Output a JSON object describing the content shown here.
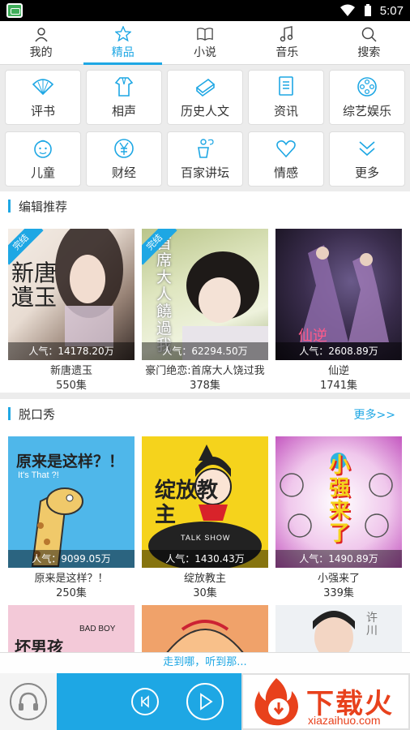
{
  "status": {
    "time": "5:07"
  },
  "tabs": [
    {
      "label": "我的",
      "icon": "person-icon",
      "active": false
    },
    {
      "label": "精品",
      "icon": "star-icon",
      "active": true
    },
    {
      "label": "小说",
      "icon": "book-icon",
      "active": false
    },
    {
      "label": "音乐",
      "icon": "music-note-icon",
      "active": false
    },
    {
      "label": "搜索",
      "icon": "search-icon",
      "active": false
    }
  ],
  "categories": [
    {
      "label": "评书",
      "icon": "fan-icon"
    },
    {
      "label": "相声",
      "icon": "robe-icon"
    },
    {
      "label": "历史人文",
      "icon": "scroll-book-icon"
    },
    {
      "label": "资讯",
      "icon": "document-icon"
    },
    {
      "label": "综艺娱乐",
      "icon": "film-reel-icon"
    },
    {
      "label": "儿童",
      "icon": "child-face-icon"
    },
    {
      "label": "财经",
      "icon": "yen-coin-icon"
    },
    {
      "label": "百家讲坛",
      "icon": "lectern-icon"
    },
    {
      "label": "情感",
      "icon": "heart-icon"
    },
    {
      "label": "更多",
      "icon": "double-chevron-down-icon"
    }
  ],
  "editor_section": {
    "title": "编辑推荐",
    "items": [
      {
        "name": "新唐遗玉",
        "count": "550集",
        "popularity": "人气：14178.20万",
        "badge": "完结",
        "cover_text": "新唐遺玉"
      },
      {
        "name": "豪门绝恋:首席大人饶过我",
        "count": "378集",
        "popularity": "人气：62294.50万",
        "badge": "完结",
        "cover_text": "首席大人饒過我"
      },
      {
        "name": "仙逆",
        "count": "1741集",
        "popularity": "人气：2608.89万",
        "badge": "",
        "cover_text": "仙逆"
      }
    ]
  },
  "talk_section": {
    "title": "脱口秀",
    "more": "更多>>",
    "items": [
      {
        "name": "原来是这样？！",
        "count": "250集",
        "popularity": "人气：9099.05万",
        "cover_text": "原来是这样？！",
        "cover_sub": "It's That ?!"
      },
      {
        "name": "绽放教主",
        "count": "30集",
        "popularity": "人气：1430.43万",
        "cover_text": "绽放教主",
        "cover_sub": "TALK SHOW"
      },
      {
        "name": "小强来了",
        "count": "339集",
        "popularity": "人气：1490.89万",
        "cover_text": "小强来了",
        "cover_sub": ""
      }
    ],
    "partial_covers": [
      {
        "cover_text": "坏男孩",
        "cover_sub": "BAD BOY"
      },
      {
        "cover_text": "",
        "cover_sub": ""
      },
      {
        "cover_text": "许川",
        "cover_sub": ""
      }
    ]
  },
  "marquee": {
    "text": "走到哪，听到那..."
  },
  "watermark": {
    "brand": "下载火",
    "url": "xiazaihuo.com"
  },
  "colors": {
    "accent": "#1ea7e4",
    "brand_red": "#e8411c"
  }
}
